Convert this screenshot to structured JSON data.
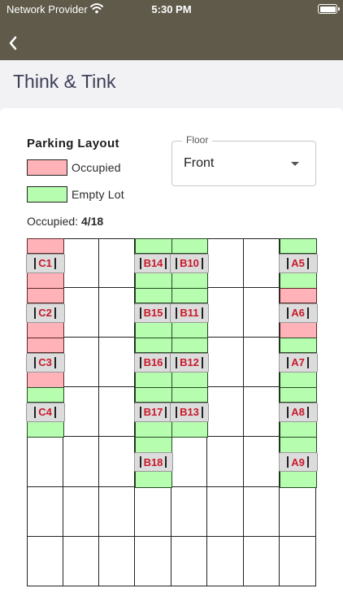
{
  "status_bar": {
    "carrier": "Network Provider",
    "time": "5:30 PM"
  },
  "header": {
    "title": "Think & Tink"
  },
  "legend": {
    "title": "Parking Layout",
    "occupied_label": "Occupied",
    "empty_label": "Empty Lot",
    "occupied_color": "#ffb3b8",
    "empty_color": "#b6fdb0"
  },
  "occupancy": {
    "label": "Occupied:",
    "value": "4/18"
  },
  "floor": {
    "label": "Floor",
    "value": "Front"
  },
  "lots": [
    {
      "id": "C1",
      "status": "occupied",
      "column": 0,
      "row": 0
    },
    {
      "id": "C2",
      "status": "occupied",
      "column": 0,
      "row": 1
    },
    {
      "id": "C3",
      "status": "occupied",
      "column": 0,
      "row": 2
    },
    {
      "id": "C4",
      "status": "empty",
      "column": 0,
      "row": 3
    },
    {
      "id": "B14",
      "status": "empty",
      "column": 3,
      "row": 0
    },
    {
      "id": "B15",
      "status": "empty",
      "column": 3,
      "row": 1
    },
    {
      "id": "B16",
      "status": "empty",
      "column": 3,
      "row": 2
    },
    {
      "id": "B17",
      "status": "empty",
      "column": 3,
      "row": 3
    },
    {
      "id": "B18",
      "status": "empty",
      "column": 3,
      "row": 4
    },
    {
      "id": "B10",
      "status": "empty",
      "column": 4,
      "row": 0
    },
    {
      "id": "B11",
      "status": "empty",
      "column": 4,
      "row": 1
    },
    {
      "id": "B12",
      "status": "empty",
      "column": 4,
      "row": 2
    },
    {
      "id": "B13",
      "status": "empty",
      "column": 4,
      "row": 3
    },
    {
      "id": "A5",
      "status": "empty",
      "column": 7,
      "row": 0
    },
    {
      "id": "A6",
      "status": "occupied",
      "column": 7,
      "row": 1
    },
    {
      "id": "A7",
      "status": "empty",
      "column": 7,
      "row": 2
    },
    {
      "id": "A8",
      "status": "empty",
      "column": 7,
      "row": 3
    },
    {
      "id": "A9",
      "status": "empty",
      "column": 7,
      "row": 4
    }
  ],
  "layout_grid": {
    "columns": 8,
    "rows": 7
  }
}
